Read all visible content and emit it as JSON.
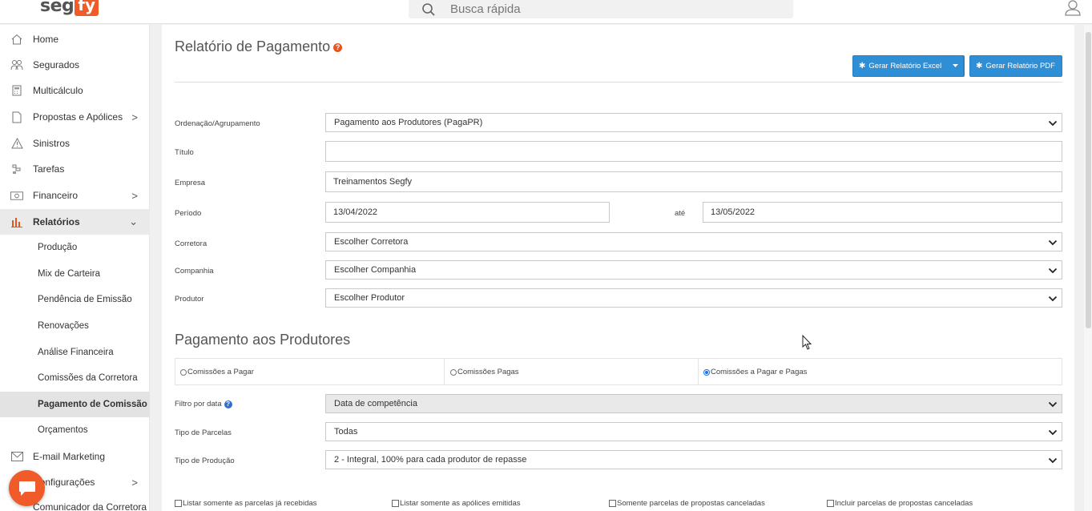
{
  "header": {
    "logo_seg": "seg",
    "logo_fy": "fy",
    "search_placeholder": "Busca rápida"
  },
  "sidebar": {
    "items": [
      {
        "label": "Home",
        "icon": "home-icon"
      },
      {
        "label": "Segurados",
        "icon": "users-icon"
      },
      {
        "label": "Multicálculo",
        "icon": "calculator-icon"
      },
      {
        "label": "Propostas e Apólices",
        "icon": "document-icon",
        "chevron": ">"
      },
      {
        "label": "Sinistros",
        "icon": "warning-icon"
      },
      {
        "label": "Tarefas",
        "icon": "tasks-icon"
      },
      {
        "label": "Financeiro",
        "icon": "money-icon",
        "chevron": ">"
      },
      {
        "label": "Relatórios",
        "icon": "bar-chart-icon",
        "chevron": "⌄"
      }
    ],
    "sub_items": [
      {
        "label": "Produção"
      },
      {
        "label": "Mix de Carteira"
      },
      {
        "label": "Pendência de Emissão"
      },
      {
        "label": "Renovações"
      },
      {
        "label": "Análise Financeira"
      },
      {
        "label": "Comissões da Corretora"
      },
      {
        "label": "Pagamento de Comissão"
      },
      {
        "label": "Orçamentos"
      }
    ],
    "bottom_items": [
      {
        "label": "E-mail Marketing",
        "icon": "mail-icon"
      },
      {
        "label": "Configurações",
        "icon": "gear-icon",
        "chevron": ">"
      },
      {
        "label": "Comunicador da Corretora",
        "icon": "chat-icon"
      }
    ]
  },
  "page": {
    "title": "Relatório de Pagamento",
    "help_glyph": "?",
    "btn_excel": "Gerar Relatório Excel",
    "btn_pdf": "Gerar Relatório PDF"
  },
  "form": {
    "ordenacao_label": "Ordenação/Agrupamento",
    "ordenacao_value": "Pagamento aos Produtores (PagaPR)",
    "titulo_label": "Título",
    "titulo_value": "",
    "empresa_label": "Empresa",
    "empresa_value": "Treinamentos Segfy",
    "periodo_label": "Período",
    "periodo_inicio": "13/04/2022",
    "ate_label": "até",
    "periodo_fim": "13/05/2022",
    "corretora_label": "Corretora",
    "corretora_value": "Escolher Corretora",
    "companhia_label": "Companhia",
    "companhia_value": "Escolher Companhia",
    "produtor_label": "Produtor",
    "produtor_value": "Escolher Produtor"
  },
  "section": {
    "title": "Pagamento aos Produtores",
    "radios": [
      {
        "label": "Comissões a Pagar",
        "checked": false
      },
      {
        "label": "Comissões Pagas",
        "checked": false
      },
      {
        "label": "Comissões a Pagar e Pagas",
        "checked": true
      }
    ],
    "filtro_label": "Filtro por data",
    "filtro_help": "?",
    "filtro_value": "Data de competência",
    "tipo_parcelas_label": "Tipo de Parcelas",
    "tipo_parcelas_value": "Todas",
    "tipo_producao_label": "Tipo de Produção",
    "tipo_producao_value": "2 - Integral, 100% para cada produtor de repasse",
    "checkboxes": [
      {
        "label": "Listar somente as parcelas já recebidas",
        "checked": false
      },
      {
        "label": "Listar somente as apólices emitidas",
        "checked": false
      },
      {
        "label": "Somente parcelas de propostas canceladas",
        "checked": false
      },
      {
        "label": "Incluir parcelas de propostas canceladas",
        "checked": false
      }
    ]
  },
  "colors": {
    "brand_orange": "#f15a29",
    "button_blue": "#2e8fd6"
  }
}
